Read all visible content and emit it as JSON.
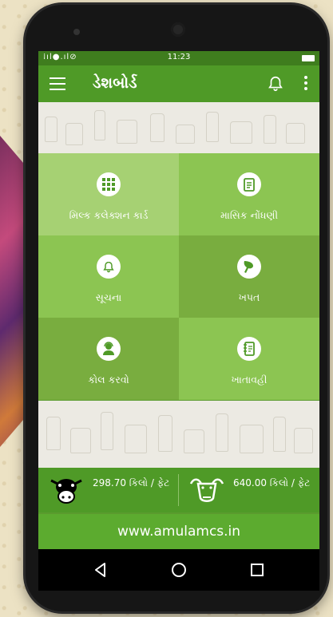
{
  "status_bar": {
    "time": "11:23",
    "indicators": "⁞ıl●.ıl⊘"
  },
  "app_bar": {
    "title": "ડેશબોર્ડ",
    "menu_icon": "hamburger-menu-icon",
    "notification_icon": "bell-icon",
    "more_icon": "more-vert-icon"
  },
  "tiles": [
    {
      "label": "મિલ્ક કલેક્શન કાર્ડ",
      "icon": "grid-icon",
      "color": "#a6d173"
    },
    {
      "label": "માસિક નોંધણી",
      "icon": "document-icon",
      "color": "#8cc552"
    },
    {
      "label": "સૂચના",
      "icon": "bell-icon",
      "color": "#8cc552"
    },
    {
      "label": "ખપત",
      "icon": "feed-icon",
      "color": "#79ad3f"
    },
    {
      "label": "કોલ કરવો",
      "icon": "support-agent-icon",
      "color": "#79ad3f"
    },
    {
      "label": "ખાતાવહી",
      "icon": "notebook-icon",
      "color": "#8cc552"
    }
  ],
  "stats": [
    {
      "animal": "cow-icon",
      "value": "298.70 કિલો / ફેટ"
    },
    {
      "animal": "buffalo-icon",
      "value": "640.00 કિલો / ફેટ"
    }
  ],
  "footer": {
    "website": "www.amulamcs.in"
  },
  "nav_bar": {
    "back": "back-icon",
    "home": "home-icon",
    "recents": "recents-icon"
  }
}
